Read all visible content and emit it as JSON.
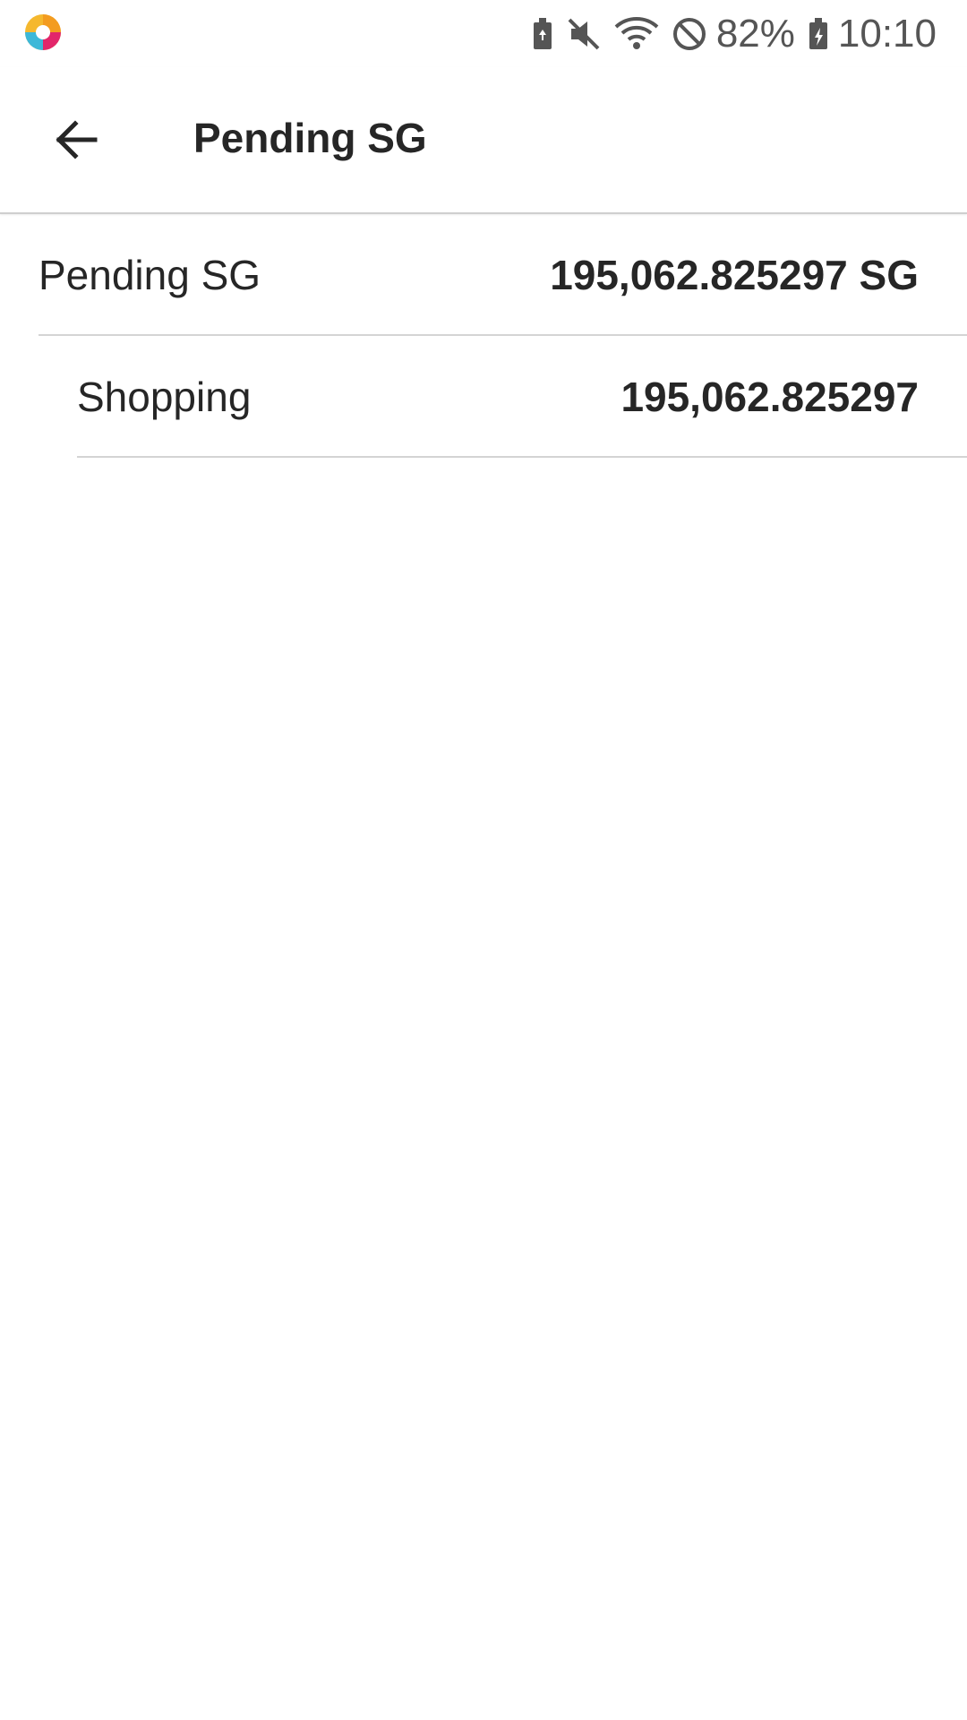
{
  "status_bar": {
    "battery_percent": "82%",
    "time": "10:10",
    "icons": [
      "app-logo-icon",
      "battery-saver-icon",
      "mute-icon",
      "wifi-icon",
      "do-not-disturb-icon",
      "battery-charging-icon"
    ]
  },
  "app_bar": {
    "title": "Pending SG",
    "back_icon": "arrow-back-icon"
  },
  "list": {
    "items": [
      {
        "label": "Pending SG",
        "value": "195,062.825297 SG"
      },
      {
        "label": "Shopping",
        "value": "195,062.825297"
      }
    ]
  }
}
